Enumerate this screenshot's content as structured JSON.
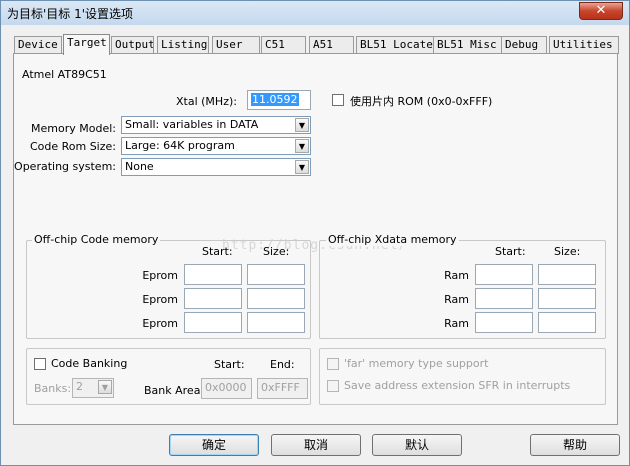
{
  "window": {
    "title": "为目标'目标 1'设置选项",
    "close_glyph": "✕"
  },
  "tabs": [
    {
      "label": "Device"
    },
    {
      "label": "Target"
    },
    {
      "label": "Output"
    },
    {
      "label": "Listing"
    },
    {
      "label": "User"
    },
    {
      "label": "C51"
    },
    {
      "label": "A51"
    },
    {
      "label": "BL51 Locate"
    },
    {
      "label": "BL51 Misc"
    },
    {
      "label": "Debug"
    },
    {
      "label": "Utilities"
    }
  ],
  "active_tab": "Target",
  "device_name": "Atmel AT89C51",
  "xtal": {
    "label": "Xtal (MHz):",
    "value": "11.0592"
  },
  "onchip_rom": {
    "label": "使用片内 ROM (0x0-0xFFF)",
    "checked": false
  },
  "memory_model": {
    "label": "Memory Model:",
    "value": "Small: variables in DATA"
  },
  "code_rom_size": {
    "label": "Code Rom Size:",
    "value": "Large: 64K program"
  },
  "operating_system": {
    "label": "Operating system:",
    "value": "None"
  },
  "code_memory": {
    "title": "Off-chip Code memory",
    "start_header": "Start:",
    "size_header": "Size:",
    "rows": [
      {
        "label": "Eprom",
        "start": "",
        "size": ""
      },
      {
        "label": "Eprom",
        "start": "",
        "size": ""
      },
      {
        "label": "Eprom",
        "start": "",
        "size": ""
      }
    ]
  },
  "xdata_memory": {
    "title": "Off-chip Xdata memory",
    "start_header": "Start:",
    "size_header": "Size:",
    "rows": [
      {
        "label": "Ram",
        "start": "",
        "size": ""
      },
      {
        "label": "Ram",
        "start": "",
        "size": ""
      },
      {
        "label": "Ram",
        "start": "",
        "size": ""
      }
    ]
  },
  "banking": {
    "code_banking_label": "Code Banking",
    "code_banking_checked": false,
    "start_header": "Start:",
    "end_header": "End:",
    "banks_label": "Banks:",
    "banks_value": "2",
    "bank_area_label": "Bank Area:",
    "bank_area_start": "0x0000",
    "bank_area_end": "0xFFFF"
  },
  "options": {
    "far_memory_label": "'far' memory type support",
    "save_sfr_label": "Save address extension SFR in interrupts"
  },
  "watermark": "http://blog.csdn.net/",
  "buttons": {
    "ok": "确定",
    "cancel": "取消",
    "defaults": "默认",
    "help": "帮助"
  },
  "icons": {
    "dropdown": "▼"
  }
}
